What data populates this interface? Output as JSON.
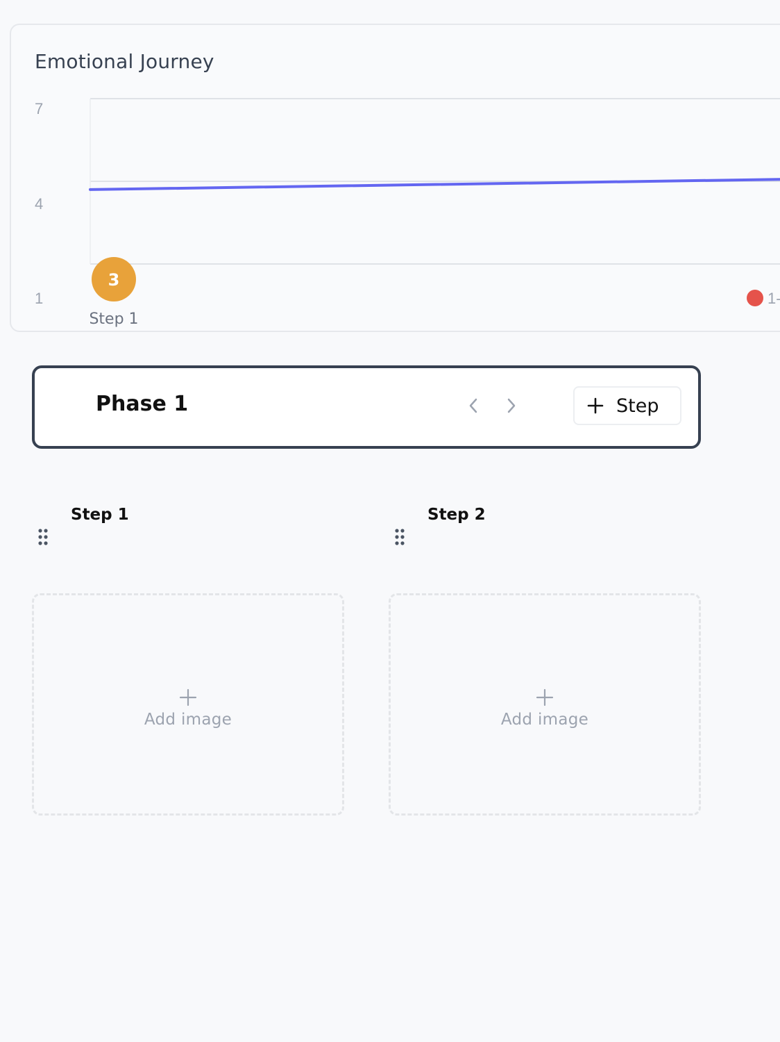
{
  "chart": {
    "title": "Emotional Journey",
    "legend_fragment": "1-"
  },
  "chart_data": {
    "type": "line",
    "title": "Emotional Journey",
    "ylim": [
      1,
      7
    ],
    "y_ticks": [
      "7",
      "4",
      "1"
    ],
    "categories": [
      "Step 1"
    ],
    "series": [
      {
        "values": [
          3.7
        ],
        "color": "#6366f1"
      }
    ],
    "point_badges": [
      {
        "category": "Step 1",
        "label": "3",
        "color": "#e8a23a"
      }
    ],
    "legend": [
      {
        "label": "1-",
        "color": "#e5534b"
      }
    ],
    "grid": true
  },
  "phase": {
    "title": "Phase 1",
    "prev_icon": "chevron-left-icon",
    "next_icon": "chevron-right-icon",
    "add_step_label": "Step"
  },
  "steps": [
    {
      "title": "Step 1",
      "add_image_label": "Add image"
    },
    {
      "title": "Step 2",
      "add_image_label": "Add image"
    }
  ],
  "colors": {
    "line": "#6366f1",
    "badge": "#e8a23a",
    "legend_dot": "#e5534b",
    "border_dark": "#374151"
  }
}
